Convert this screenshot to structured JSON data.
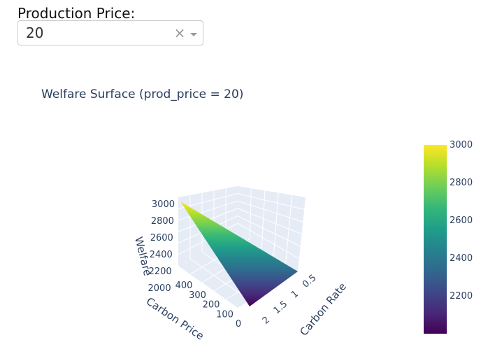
{
  "dropdown": {
    "label": "Production Price:",
    "value": "20",
    "clear_symbol": "×",
    "clear_icon": "close-icon",
    "arrow_icon": "chevron-down-icon"
  },
  "chart_data": {
    "type": "surface",
    "title": "Welfare Surface (prod_price = 20)",
    "xlabel": "Carbon Rate",
    "ylabel": "Carbon Price",
    "zlabel": "Welfare",
    "x_ticks": [
      "0.5",
      "1",
      "1.5",
      "2"
    ],
    "y_ticks": [
      "0",
      "100",
      "200",
      "300",
      "400"
    ],
    "z_ticks": [
      "2000",
      "2200",
      "2400",
      "2600",
      "2800",
      "3000"
    ],
    "colorscale": "Viridis",
    "colorbar_ticks": [
      "2200",
      "2400",
      "2600",
      "2800",
      "3000"
    ],
    "colorbar_range": [
      2000,
      3000
    ],
    "colors": [
      "#440154",
      "#482878",
      "#3e4989",
      "#31688e",
      "#26828e",
      "#1f9e89",
      "#35b779",
      "#6ece58",
      "#b5de2b",
      "#fde725"
    ],
    "surface_points": [
      {
        "carbon_rate": 0.5,
        "carbon_price": 400,
        "welfare": 3000
      },
      {
        "carbon_rate": 0.5,
        "carbon_price": 0,
        "welfare": 2000
      },
      {
        "carbon_rate": 2,
        "carbon_price": 0,
        "welfare": 2000
      }
    ]
  }
}
